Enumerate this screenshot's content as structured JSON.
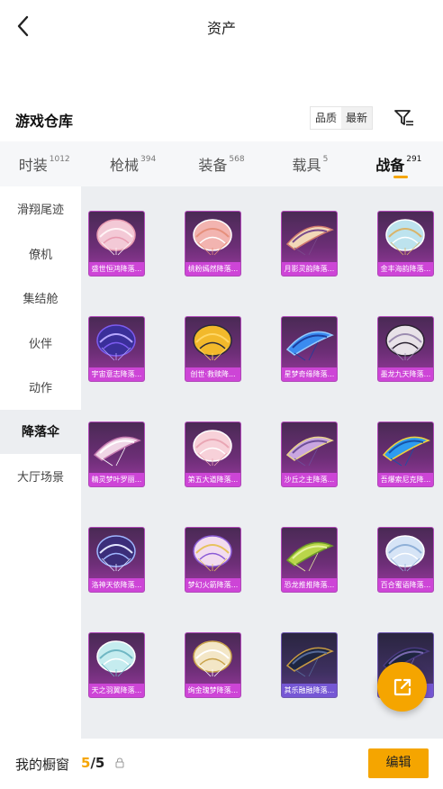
{
  "header": {
    "title": "资产",
    "back_icon": "chevron-left-icon"
  },
  "section": {
    "title": "游戏仓库",
    "sort_options": [
      {
        "label": "品质",
        "active": false
      },
      {
        "label": "最新",
        "active": true
      }
    ],
    "filter_icon": "filter-icon"
  },
  "tabs": [
    {
      "label": "时装",
      "count": "1012",
      "active": false
    },
    {
      "label": "枪械",
      "count": "394",
      "active": false
    },
    {
      "label": "装备",
      "count": "568",
      "active": false
    },
    {
      "label": "载具",
      "count": "5",
      "active": false
    },
    {
      "label": "战备",
      "count": "291",
      "active": true
    }
  ],
  "sidebar": [
    {
      "label": "滑翔尾迹",
      "active": false
    },
    {
      "label": "僚机",
      "active": false
    },
    {
      "label": "集结舱",
      "active": false
    },
    {
      "label": "伙伴",
      "active": false
    },
    {
      "label": "动作",
      "active": false
    },
    {
      "label": "降落伞",
      "active": true
    },
    {
      "label": "大厅场景",
      "active": false
    }
  ],
  "items": [
    {
      "name": "盛世恒鸿降落...",
      "palette": [
        "#f3c9d6",
        "#e89ab0",
        "#fff4f6"
      ],
      "kind": "dome"
    },
    {
      "name": "桃粉嫣然降落...",
      "palette": [
        "#f2b4b0",
        "#ffffff",
        "#e6907c"
      ],
      "kind": "dome"
    },
    {
      "name": "月影灵韵降落...",
      "palette": [
        "#f2d8b8",
        "#d07a6e",
        "#7a4b8c"
      ],
      "kind": "wing"
    },
    {
      "name": "金丰海韵降落...",
      "palette": [
        "#bde3ee",
        "#ffffff",
        "#d9b46a"
      ],
      "kind": "dome"
    },
    {
      "name": "宇宙意志降落...",
      "palette": [
        "#3a2f9a",
        "#7d5cf0",
        "#b7a7ff"
      ],
      "kind": "dome"
    },
    {
      "name": "创世·救赎降...",
      "palette": [
        "#f2b92b",
        "#2a2a3a",
        "#ffd766"
      ],
      "kind": "dome"
    },
    {
      "name": "星梦奇缘降落...",
      "palette": [
        "#3b8bf0",
        "#94ccff",
        "#1d3e9e"
      ],
      "kind": "wing"
    },
    {
      "name": "墨龙九天降落...",
      "palette": [
        "#e8e2e8",
        "#2a2230",
        "#9c8cb0"
      ],
      "kind": "dome"
    },
    {
      "name": "精灵梦叶罗丽...",
      "palette": [
        "#f0d6e6",
        "#c57ab0",
        "#ffffff"
      ],
      "kind": "wing"
    },
    {
      "name": "第五大道降落...",
      "palette": [
        "#f7d1d9",
        "#ffffff",
        "#e9a6b4"
      ],
      "kind": "dome"
    },
    {
      "name": "沙丘之主降落...",
      "palette": [
        "#c9a6e0",
        "#e8d38a",
        "#6e4f9b"
      ],
      "kind": "wing"
    },
    {
      "name": "吾爆索尼克降...",
      "palette": [
        "#2e9bf0",
        "#f0d23c",
        "#1653a8"
      ],
      "kind": "wing"
    },
    {
      "name": "洛神天依降落...",
      "palette": [
        "#3b2e7a",
        "#9fb7ff",
        "#e2e6ff"
      ],
      "kind": "dome"
    },
    {
      "name": "梦幻火箭降落...",
      "palette": [
        "#f2dcef",
        "#8a5bd6",
        "#e7c25e"
      ],
      "kind": "dome"
    },
    {
      "name": "恐龙推推降落...",
      "palette": [
        "#b9d64a",
        "#6e9a2a",
        "#e6f2a0"
      ],
      "kind": "wing"
    },
    {
      "name": "百合蜜语降落...",
      "palette": [
        "#d6e4f6",
        "#ffffff",
        "#8fb0d8"
      ],
      "kind": "dome"
    },
    {
      "name": "天之羽翼降落...",
      "palette": [
        "#c5ecef",
        "#ffffff",
        "#6fb7c4"
      ],
      "kind": "dome"
    },
    {
      "name": "绚金瑰梦降落...",
      "palette": [
        "#f3e6c6",
        "#c8a24a",
        "#ffffff"
      ],
      "kind": "dome"
    },
    {
      "name": "其乐融融降落...",
      "palette": [
        "#1e2540",
        "#c79a42",
        "#556a9a"
      ],
      "kind": "wing",
      "dark": true
    },
    {
      "name": "...",
      "palette": [
        "#1e2540",
        "#4a3a80",
        "#7a6ab0"
      ],
      "kind": "wing",
      "dark": true
    }
  ],
  "fab_icon": "share-external-icon",
  "footer": {
    "label": "我的橱窗",
    "current": "5",
    "total": "/5",
    "lock_icon": "lock-icon",
    "edit_label": "编辑"
  },
  "colors": {
    "accent": "#f5a500",
    "item_bg": "#6c2e76",
    "item_label_bg": "#d246dc"
  }
}
